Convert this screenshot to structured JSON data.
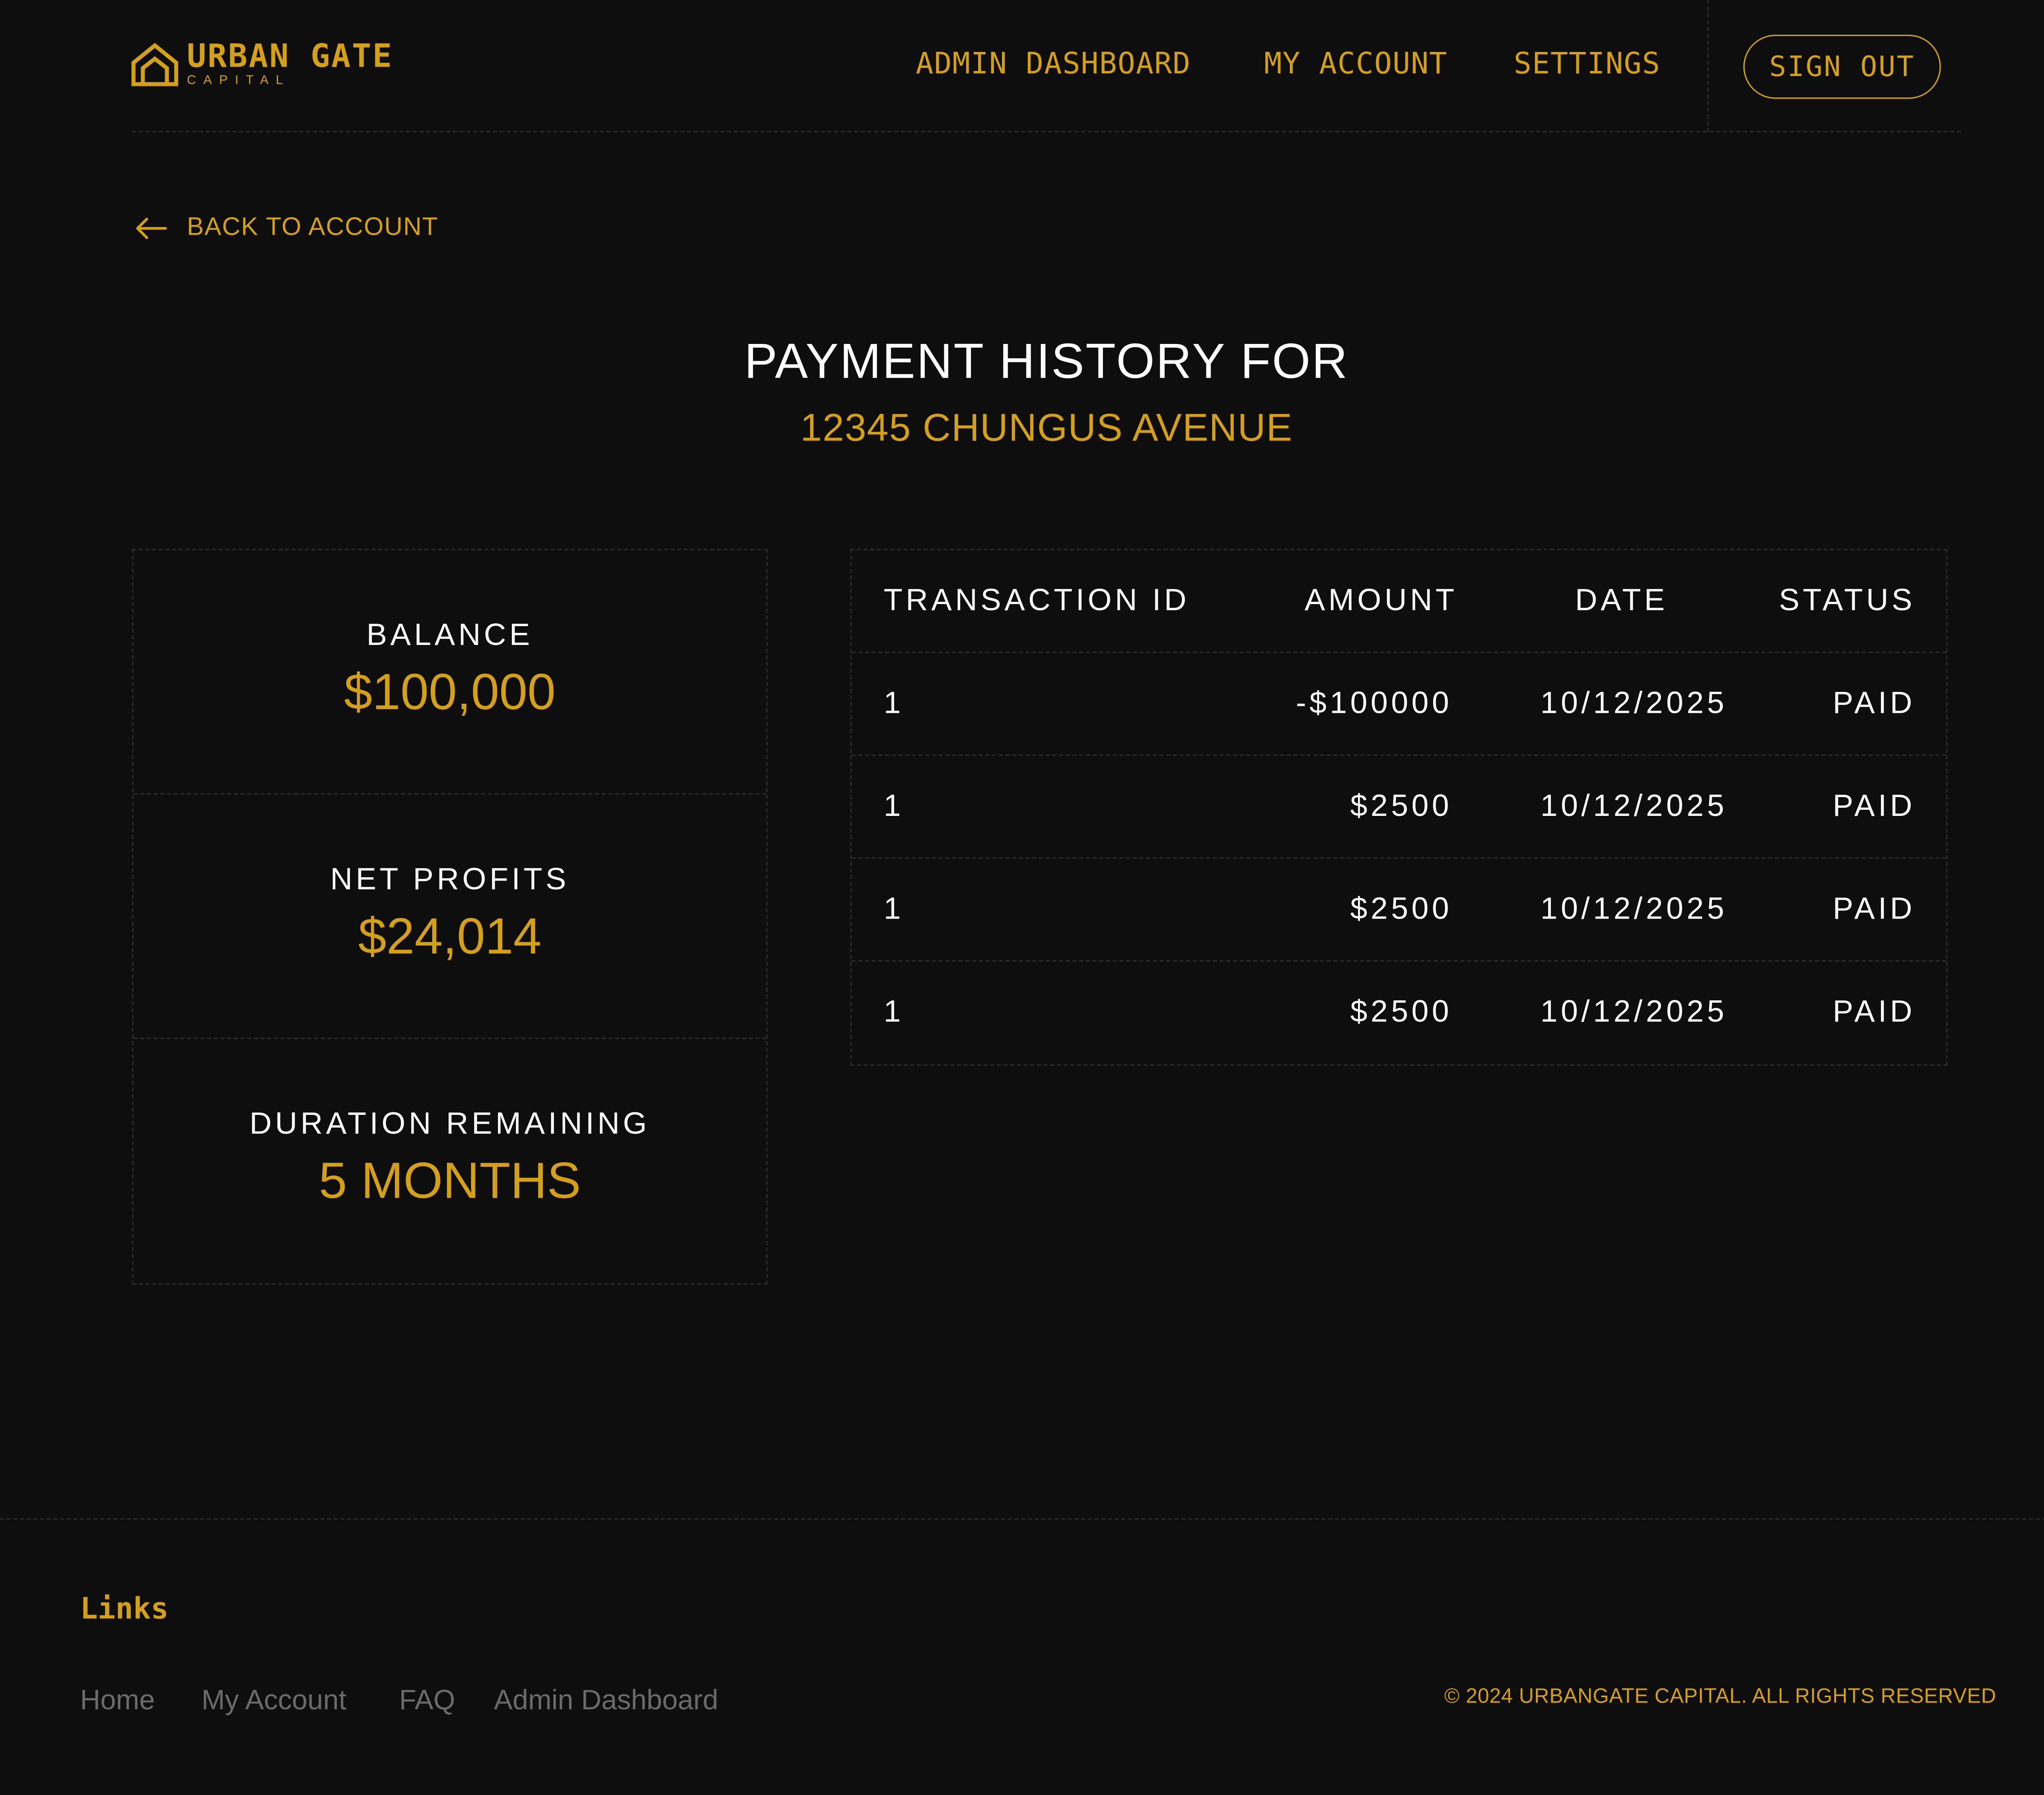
{
  "brand": {
    "name": "URBAN GATE",
    "sub": "CAPITAL",
    "color": "#d4a017",
    "logo_icon": "house-icon"
  },
  "nav": {
    "items": [
      "ADMIN DASHBOARD",
      "MY ACCOUNT",
      "SETTINGS"
    ],
    "signout": "SIGN OUT"
  },
  "back": {
    "label": "BACK TO ACCOUNT",
    "icon": "arrow-left-icon"
  },
  "heading": {
    "line1": "PAYMENT HISTORY FOR",
    "line2": "12345 CHUNGUS AVENUE"
  },
  "stats": [
    {
      "label": "BALANCE",
      "value": "$100,000"
    },
    {
      "label": "NET PROFITS",
      "value": "$24,014"
    },
    {
      "label": "DURATION REMAINING",
      "value": "5 MONTHS"
    }
  ],
  "table": {
    "headers": {
      "id": "TRANSACTION ID",
      "amount": "AMOUNT",
      "date": "DATE",
      "status": "STATUS"
    },
    "rows": [
      {
        "id": "1",
        "amount": "-$100000",
        "date": "10/12/2025",
        "status": "PAID"
      },
      {
        "id": "1",
        "amount": "$2500",
        "date": "10/12/2025",
        "status": "PAID"
      },
      {
        "id": "1",
        "amount": "$2500",
        "date": "10/12/2025",
        "status": "PAID"
      },
      {
        "id": "1",
        "amount": "$2500",
        "date": "10/12/2025",
        "status": "PAID"
      }
    ]
  },
  "footer": {
    "links_title": "Links",
    "links": [
      "Home",
      "My Account",
      "FAQ",
      "Admin Dashboard"
    ],
    "copyright": "© 2024 URBANGATE CAPITAL. ALL RIGHTS RESERVED"
  },
  "colors": {
    "background": "#0e0e0e",
    "accent": "#d4a017",
    "text": "#ffffff",
    "muted": "#6a6a6a"
  }
}
